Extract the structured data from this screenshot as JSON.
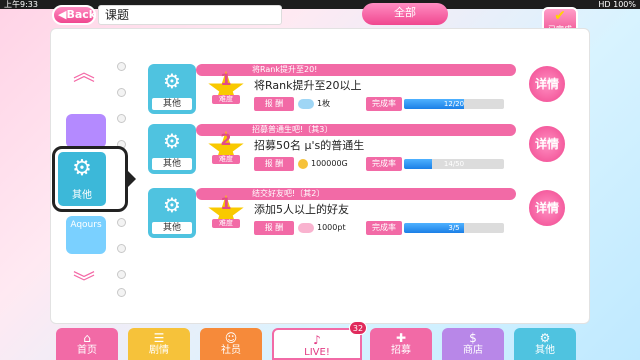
{
  "statusbar": {
    "time": "上午9:33",
    "right": "HD  100%"
  },
  "header": {
    "back_label": "Back",
    "title": "课题",
    "filter_label": "全部",
    "done_badge_label": "已完成"
  },
  "sidebar": {
    "other_tab_label": "其他",
    "aqours_label": "Aqours"
  },
  "tasks": [
    {
      "category": "其他",
      "header": "将Rank提升至20!",
      "difficulty": "1",
      "difficulty_label": "难度",
      "name": "将Rank提升至20以上",
      "reward_label": "报 酬",
      "reward": "1枚",
      "rate_label": "完成率",
      "progress": "12/20",
      "progress_fraction": 0.6,
      "detail": "详情"
    },
    {
      "category": "其他",
      "header": "招募普通生吧!〔其3〕",
      "difficulty": "2",
      "difficulty_label": "难度",
      "name": "招募50名 μ's的普通生",
      "reward_label": "报 酬",
      "reward": "100000G",
      "rate_label": "完成率",
      "progress": "14/50",
      "progress_fraction": 0.28,
      "detail": "详情"
    },
    {
      "category": "其他",
      "header": "结交好友吧!〔其2〕",
      "difficulty": "1",
      "difficulty_label": "难度",
      "name": "添加5人以上的好友",
      "reward_label": "报 酬",
      "reward": "1000pt",
      "rate_label": "完成率",
      "progress": "3/5",
      "progress_fraction": 0.6,
      "detail": "详情"
    }
  ],
  "bottom_nav": [
    {
      "label": "首页",
      "icon": "home-icon",
      "color": "#f26aa6"
    },
    {
      "label": "剧情",
      "icon": "story-icon",
      "color": "#f6c23a"
    },
    {
      "label": "社员",
      "icon": "member-icon",
      "color": "#f68a3a"
    },
    {
      "label": "LIVE!",
      "icon": "live-icon",
      "color": "#f26aa6"
    },
    {
      "label": "招募",
      "icon": "scout-icon",
      "color": "#f26aa6"
    },
    {
      "label": "商店",
      "icon": "shop-icon",
      "color": "#b887e8"
    },
    {
      "label": "其他",
      "icon": "other-icon",
      "color": "#4fc3e0"
    }
  ],
  "live_badge": "32"
}
